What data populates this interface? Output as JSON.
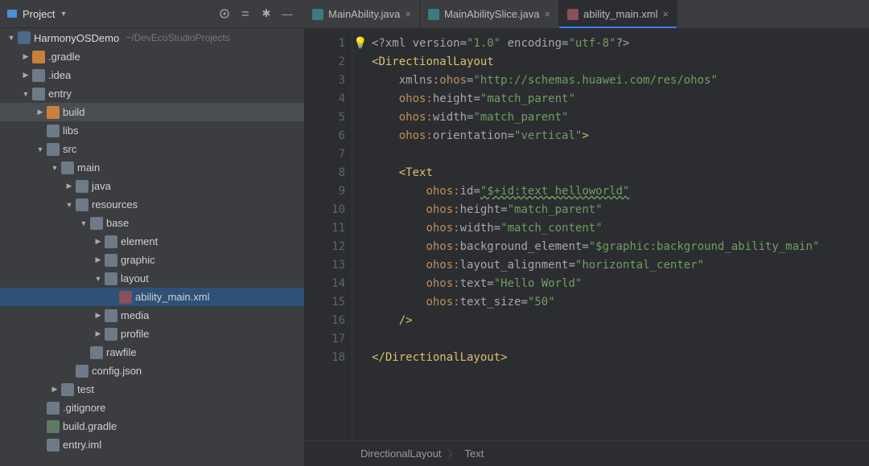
{
  "sidebar": {
    "title": "Project",
    "project_name": "HarmonyOSDemo",
    "project_path": "~/DevEcoStudioProjects",
    "tree": [
      {
        "indent": 1,
        "arrow": "▶",
        "iconClass": "ico-folder-o",
        "label": ".gradle"
      },
      {
        "indent": 1,
        "arrow": "▶",
        "iconClass": "ico-folder",
        "label": ".idea"
      },
      {
        "indent": 1,
        "arrow": "▼",
        "iconClass": "ico-folder",
        "label": "entry"
      },
      {
        "indent": 2,
        "arrow": "▶",
        "iconClass": "ico-folder-o",
        "label": "build",
        "hl": true
      },
      {
        "indent": 2,
        "arrow": "",
        "iconClass": "ico-folder",
        "label": "libs"
      },
      {
        "indent": 2,
        "arrow": "▼",
        "iconClass": "ico-folder",
        "label": "src"
      },
      {
        "indent": 3,
        "arrow": "▼",
        "iconClass": "ico-folder",
        "label": "main"
      },
      {
        "indent": 4,
        "arrow": "▶",
        "iconClass": "ico-folder",
        "label": "java"
      },
      {
        "indent": 4,
        "arrow": "▼",
        "iconClass": "ico-folder",
        "label": "resources"
      },
      {
        "indent": 5,
        "arrow": "▼",
        "iconClass": "ico-folder",
        "label": "base"
      },
      {
        "indent": 6,
        "arrow": "▶",
        "iconClass": "ico-folder",
        "label": "element"
      },
      {
        "indent": 6,
        "arrow": "▶",
        "iconClass": "ico-folder",
        "label": "graphic"
      },
      {
        "indent": 6,
        "arrow": "▼",
        "iconClass": "ico-folder",
        "label": "layout"
      },
      {
        "indent": 7,
        "arrow": "",
        "iconClass": "ico-file-xml",
        "label": "ability_main.xml",
        "sel": true
      },
      {
        "indent": 6,
        "arrow": "▶",
        "iconClass": "ico-folder",
        "label": "media"
      },
      {
        "indent": 6,
        "arrow": "▶",
        "iconClass": "ico-folder",
        "label": "profile"
      },
      {
        "indent": 5,
        "arrow": "",
        "iconClass": "ico-folder",
        "label": "rawfile"
      },
      {
        "indent": 4,
        "arrow": "",
        "iconClass": "ico-file",
        "label": "config.json"
      },
      {
        "indent": 3,
        "arrow": "▶",
        "iconClass": "ico-folder",
        "label": "test"
      },
      {
        "indent": 2,
        "arrow": "",
        "iconClass": "ico-file",
        "label": ".gitignore"
      },
      {
        "indent": 2,
        "arrow": "",
        "iconClass": "ico-gradle",
        "label": "build.gradle"
      },
      {
        "indent": 2,
        "arrow": "",
        "iconClass": "ico-file",
        "label": "entry.iml"
      }
    ]
  },
  "tabs": [
    {
      "label": "MainAbility.java",
      "iconClass": "java",
      "active": false
    },
    {
      "label": "MainAbilitySlice.java",
      "iconClass": "java",
      "active": false
    },
    {
      "label": "ability_main.xml",
      "iconClass": "xml",
      "active": true
    }
  ],
  "code": {
    "lines": [
      1,
      2,
      3,
      4,
      5,
      6,
      7,
      8,
      9,
      10,
      11,
      12,
      13,
      14,
      15,
      16,
      17,
      18
    ],
    "xml_decl": "<?xml version=\"1.0\" encoding=\"utf-8\"?>",
    "root_tag": "DirectionalLayout",
    "root_attrs": {
      "xmlns": "xmlns:",
      "ohos_ns": "ohos",
      "ohos_val": "\"http://schemas.huawei.com/res/ohos\"",
      "height_k": "ohos:",
      "height_a": "height",
      "height_v": "\"match_parent\"",
      "width_k": "ohos:",
      "width_a": "width",
      "width_v": "\"match_parent\"",
      "orient_k": "ohos:",
      "orient_a": "orientation",
      "orient_v": "\"vertical\""
    },
    "child_tag": "Text",
    "child_attrs": {
      "id_k": "ohos:",
      "id_a": "id",
      "id_v": "\"$+id:text_helloworld\"",
      "height_k": "ohos:",
      "height_a": "height",
      "height_v": "\"match_parent\"",
      "width_k": "ohos:",
      "width_a": "width",
      "width_v": "\"match_content\"",
      "bg_k": "ohos:",
      "bg_a": "background_element",
      "bg_v": "\"$graphic:background_ability_main\"",
      "la_k": "ohos:",
      "la_a": "layout_alignment",
      "la_v": "\"horizontal_center\"",
      "txt_k": "ohos:",
      "txt_a": "text",
      "txt_v": "\"Hello World\"",
      "ts_k": "ohos:",
      "ts_a": "text_size",
      "ts_v": "\"50\""
    },
    "close_root": "</DirectionalLayout>"
  },
  "breadcrumb": [
    "DirectionalLayout",
    "Text"
  ]
}
